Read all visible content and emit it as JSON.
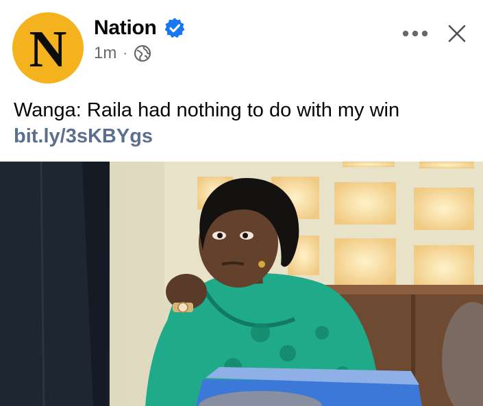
{
  "post": {
    "page_name": "Nation",
    "avatar_letter": "N",
    "timestamp": "1m",
    "separator": "·",
    "privacy_icon": "globe-icon",
    "verified_icon": "verified-badge-icon",
    "text": "Wanga: Raila had nothing to do with my win",
    "link": "bit.ly/3sKBYgs"
  },
  "colors": {
    "avatar_bg": "#f4b21e",
    "verified_blue": "#1877f2",
    "meta_gray": "#65676b",
    "link": "#5b6f8e"
  },
  "actions": {
    "more_icon": "more-horizontal-icon",
    "close_icon": "close-icon"
  }
}
